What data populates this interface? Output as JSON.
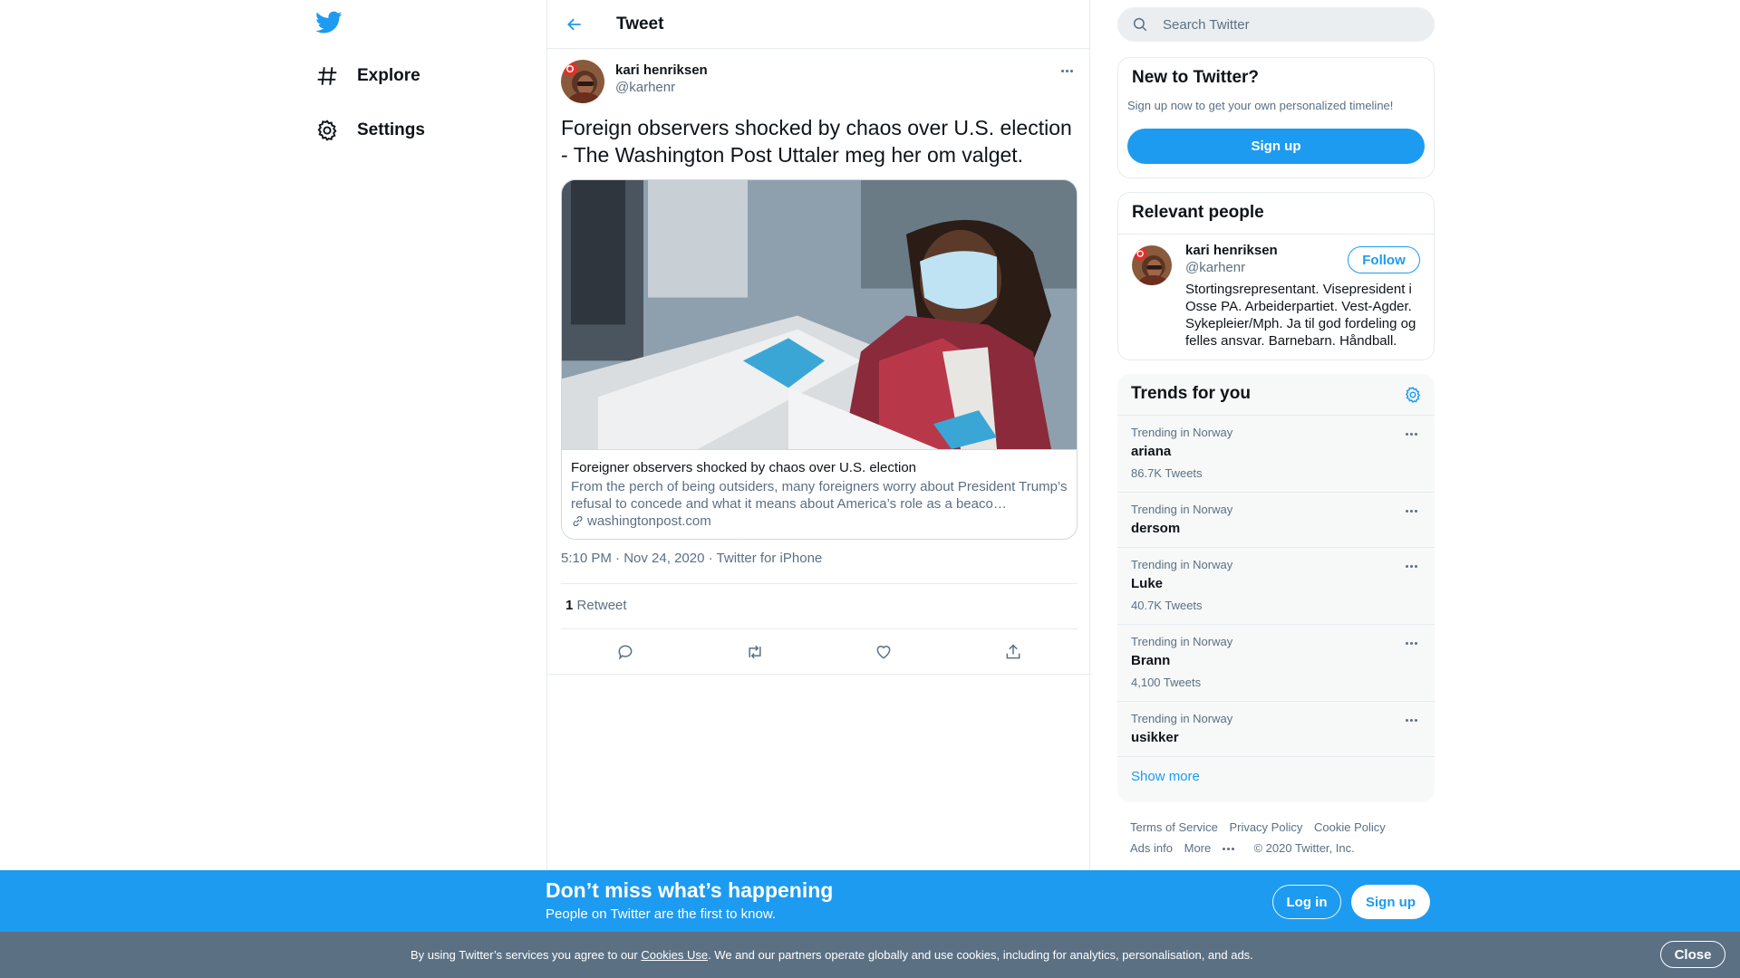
{
  "nav": {
    "logo_icon": "twitter-bird-icon",
    "items": [
      {
        "label": "Explore",
        "icon": "hashtag-icon"
      },
      {
        "label": "Settings",
        "icon": "gear-icon"
      }
    ]
  },
  "header": {
    "title": "Tweet"
  },
  "tweet": {
    "author_name": "kari henriksen",
    "author_handle": "@karhenr",
    "text": "Foreign observers shocked by chaos over U.S. election - The Washington Post Uttaler meg her om valget.",
    "card": {
      "title": "Foreigner observers shocked by chaos over U.S. election",
      "description": "From the perch of being outsiders, many foreigners worry about President Trump’s refusal to concede and what it means about America’s role as a beaco…",
      "domain": "washingtonpost.com"
    },
    "time": "5:10 PM",
    "sep": "·",
    "date": "Nov 24, 2020",
    "source": "Twitter for iPhone",
    "retweet_count": "1",
    "retweet_label": "Retweet"
  },
  "search": {
    "placeholder": "Search Twitter"
  },
  "new_to_twitter": {
    "title": "New to Twitter?",
    "subtitle": "Sign up now to get your own personalized timeline!",
    "button": "Sign up"
  },
  "relevant_people": {
    "title": "Relevant people",
    "name": "kari henriksen",
    "handle": "@karhenr",
    "follow": "Follow",
    "bio": "Stortingsrepresentant. Visepresident i Osse PA. Arbeiderpartiet. Vest-Agder. Sykepleier/Mph. Ja til god fordeling og felles ansvar. Barnebarn. Håndball."
  },
  "trends": {
    "title": "Trends for you",
    "items": [
      {
        "context": "Trending in Norway",
        "name": "ariana",
        "count": "86.7K Tweets"
      },
      {
        "context": "Trending in Norway",
        "name": "dersom",
        "count": ""
      },
      {
        "context": "Trending in Norway",
        "name": "Luke",
        "count": "40.7K Tweets"
      },
      {
        "context": "Trending in Norway",
        "name": "Brann",
        "count": "4,100 Tweets"
      },
      {
        "context": "Trending in Norway",
        "name": "usikker",
        "count": ""
      }
    ],
    "show_more": "Show more"
  },
  "footer": {
    "terms": "Terms of Service",
    "privacy": "Privacy Policy",
    "cookie": "Cookie Policy",
    "ads": "Ads info",
    "more": "More",
    "copyright": "© 2020 Twitter, Inc."
  },
  "banner": {
    "title": "Don’t miss what’s happening",
    "subtitle": "People on Twitter are the first to know.",
    "login": "Log in",
    "signup": "Sign up"
  },
  "cookie_bar": {
    "text_before": "By using Twitter’s services you agree to our ",
    "link": "Cookies Use",
    "text_after": ". We and our partners operate globally and use cookies, including for analytics, personalisation, and ads.",
    "close": "Close"
  },
  "colors": {
    "accent": "#1d9bf0",
    "secondary_text": "#5b7083",
    "cookie_bg": "#5b7083"
  }
}
